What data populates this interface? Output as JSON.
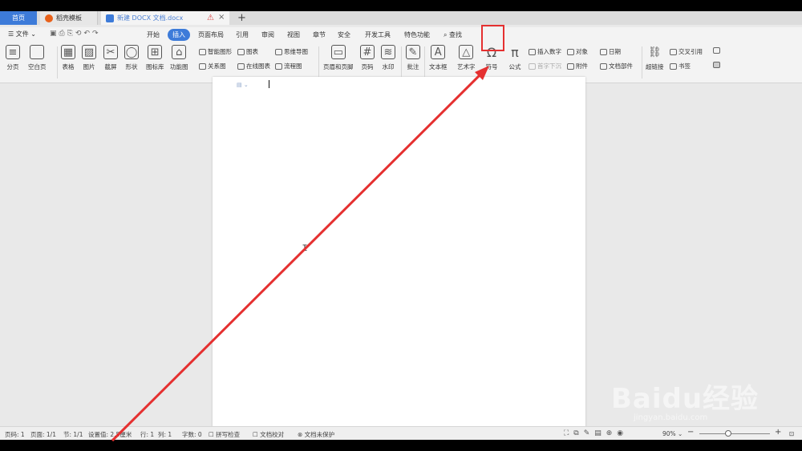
{
  "tabs": {
    "home": "首页",
    "template": "稻壳模板",
    "document": "新建 DOCX 文档.docx"
  },
  "menu": {
    "file": "文件",
    "tabs": [
      "开始",
      "插入",
      "页面布局",
      "引用",
      "审阅",
      "视图",
      "章节",
      "安全",
      "开发工具",
      "特色功能"
    ],
    "active": "插入",
    "search": "查找"
  },
  "ribbon": {
    "page_break": "分页",
    "blank_page": "空白页",
    "table": "表格",
    "picture": "图片",
    "screenshot": "截屏",
    "shape": "形状",
    "icon_lib": "图标库",
    "func_chart": "功能图",
    "smart_shape": "智能图形",
    "chart": "图表",
    "mind_map": "思维导图",
    "relation": "关系图",
    "online_chart": "在线图表",
    "flowchart": "流程图",
    "header_footer": "页眉和页脚",
    "page_number": "页码",
    "watermark": "水印",
    "comment": "批注",
    "text_box": "文本框",
    "word_art": "艺术字",
    "symbol": "符号",
    "formula": "公式",
    "insert_number": "插入数字",
    "object": "对象",
    "date": "日期",
    "drop_cap": "首字下沉",
    "attachment": "附件",
    "doc_parts": "文档部件",
    "hyperlink": "超链接",
    "cross_ref": "交叉引用",
    "bookmark": "书签"
  },
  "status": {
    "page_num": "页码: 1",
    "pages": "页面: 1/1",
    "section": "节: 1/1",
    "setting": "设置值: 2.5厘米",
    "row": "行: 1",
    "col": "列: 1",
    "words": "字数: 0",
    "spell": "拼写检查",
    "proof": "文档校对",
    "protect": "文档未保护",
    "zoom": "90%"
  },
  "watermark": {
    "brand": "Baidu经验",
    "url": "jingyan.baidu.com"
  },
  "colors": {
    "accent": "#3d7bd9",
    "highlight": "#e53030"
  }
}
